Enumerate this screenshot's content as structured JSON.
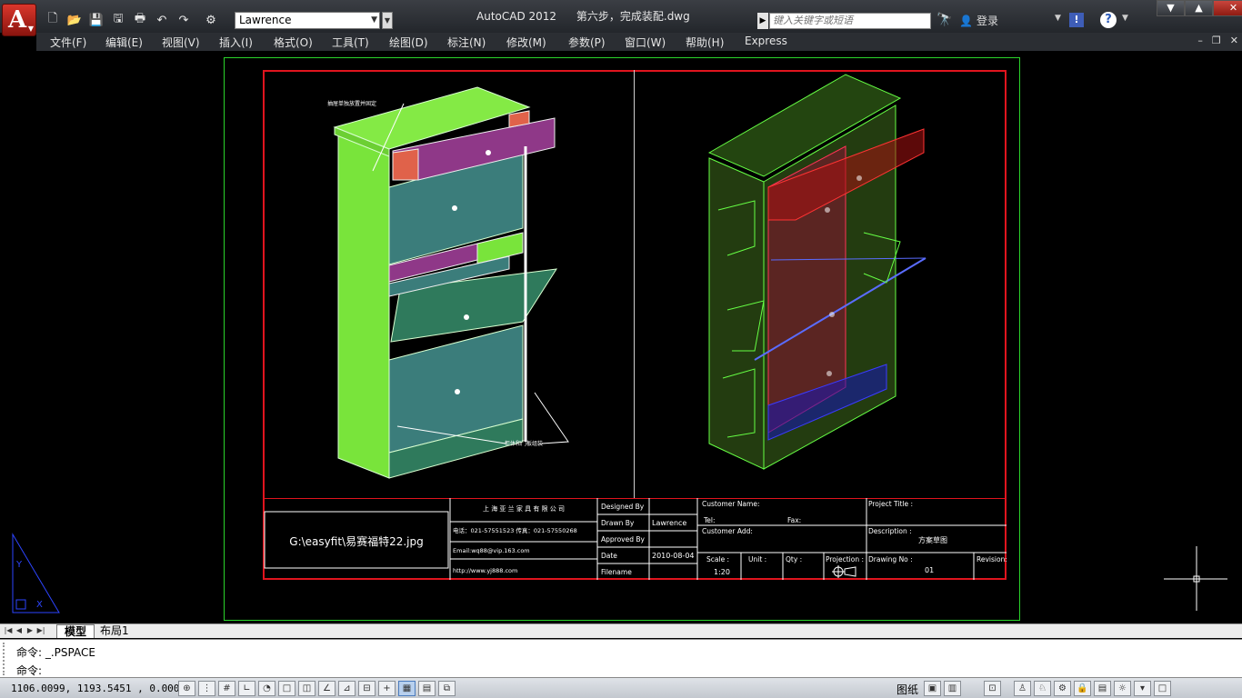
{
  "titlebar": {
    "app_title": "AutoCAD 2012",
    "file_title": "第六步，完成装配.dwg",
    "workspace": "Lawrence",
    "search_placeholder": "键入关键字或短语",
    "login_label": "登录"
  },
  "menu": [
    "文件(F)",
    "编辑(E)",
    "视图(V)",
    "插入(I)",
    "格式(O)",
    "工具(T)",
    "绘图(D)",
    "标注(N)",
    "修改(M)",
    "参数(P)",
    "窗口(W)",
    "帮助(H)",
    "Express"
  ],
  "drawing": {
    "left_annotation_top": "抽屉单独放置并固定",
    "left_annotation_bottom": "柜体和门板组装",
    "image_path": "G:\\easyfit\\易赛福特22.jpg"
  },
  "titleblock": {
    "company": "上 海 亚 兰 家 具 有 限 公 司",
    "phone": "电话：021-57551523 传真：021-57550268",
    "email": "Email:wq88@vip.163.com",
    "website": "http://www.yj888.com",
    "designed_by_label": "Designed By",
    "drawn_by_label": "Drawn By",
    "drawn_by_value": "Lawrence",
    "approved_by_label": "Approved By",
    "date_label": "Date",
    "date_value": "2010-08-04",
    "filename_label": "Filename",
    "customer_name_label": "Customer Name:",
    "tel_label": "Tel:",
    "fax_label": "Fax:",
    "customer_add_label": "Customer Add:",
    "scale_label": "Scale :",
    "scale_value": "1:20",
    "unit_label": "Unit :",
    "qty_label": "Qty :",
    "projection_label": "Projection :",
    "project_title_label": "Project Title :",
    "description_label": "Description :",
    "description_value": "方案草图",
    "drawing_no_label": "Drawing No :",
    "drawing_no_value": "01",
    "revision_label": "Revision:"
  },
  "tabs": {
    "model": "模型",
    "layout": "布局1"
  },
  "command": {
    "history": "命令: _.PSPACE",
    "prompt": "命令:"
  },
  "status": {
    "coordinates": "1106.0099, 1193.5451 , 0.0000",
    "paper_label": "图纸"
  }
}
